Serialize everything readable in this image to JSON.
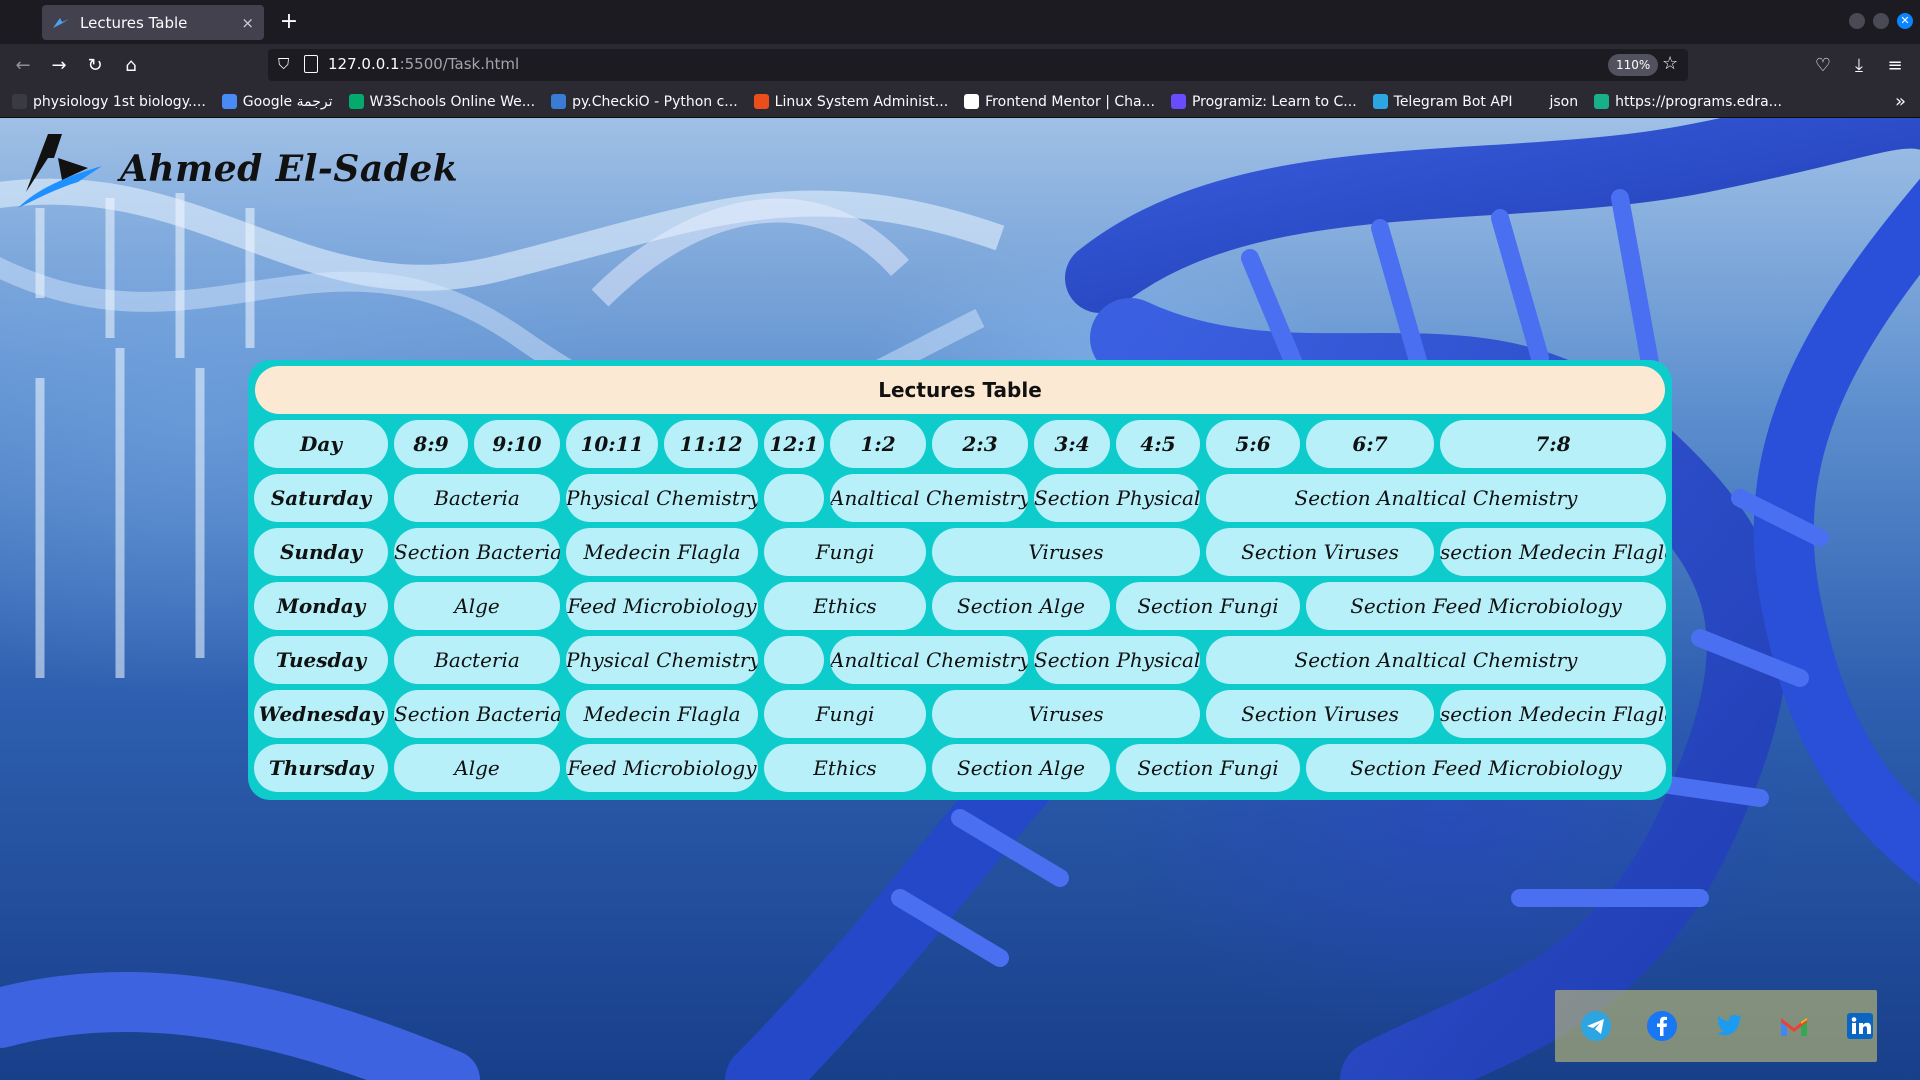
{
  "browser": {
    "tab_title": "Lectures Table",
    "tab_close": "×",
    "new_tab": "+",
    "url_host": "127.0.0.1",
    "url_path": ":5500/Task.html",
    "zoom": "110%",
    "bookmarks": [
      {
        "label": "physiology 1st biology....",
        "color": "#3a3a44"
      },
      {
        "label": "Google ترجمة",
        "color": "#4a8af4"
      },
      {
        "label": "W3Schools Online We...",
        "color": "#04aa6d"
      },
      {
        "label": "py.CheckiO - Python c...",
        "color": "#3a7bd5"
      },
      {
        "label": "Linux System Administ...",
        "color": "#e94e1b"
      },
      {
        "label": "Frontend Mentor | Cha...",
        "color": "#ffffff"
      },
      {
        "label": "Programiz: Learn to C...",
        "color": "#6a4cff"
      },
      {
        "label": "Telegram Bot API",
        "color": "#2ca5e0"
      },
      {
        "label": "json",
        "color": "#2b2a33"
      },
      {
        "label": "https://programs.edra...",
        "color": "#18b08a"
      }
    ]
  },
  "page": {
    "brand": "Ahmed El-Sadek"
  },
  "table": {
    "caption": "Lectures Table",
    "header": [
      "Day",
      "8:9",
      "9:10",
      "10:11",
      "11:12",
      "12:1",
      "1:2",
      "2:3",
      "3:4",
      "4:5",
      "5:6",
      "6:7",
      "7:8"
    ],
    "rows": [
      {
        "day": "Saturday",
        "cells": [
          "Bacteria",
          "Physical Chemistry",
          "",
          "Analtical Chemistry",
          "Section Physical Chemistry",
          "Section Analtical Chemistry"
        ]
      },
      {
        "day": "Sunday",
        "cells": [
          "Section Bacteria",
          "Medecin Flagla",
          "Fungi",
          "Viruses",
          "Section Viruses",
          "section Medecin Flagla"
        ]
      },
      {
        "day": "Monday",
        "cells": [
          "Alge",
          "Feed Microbiology",
          "Ethics",
          "Section Alge",
          "Section Fungi",
          "Section Feed Microbiology"
        ]
      },
      {
        "day": "Tuesday",
        "cells": [
          "Bacteria",
          "Physical Chemistry",
          "",
          "Analtical Chemistry",
          "Section Physical Chemistry",
          "Section Analtical Chemistry"
        ]
      },
      {
        "day": "Wednesday",
        "cells": [
          "Section Bacteria",
          "Medecin Flagla",
          "Fungi",
          "Viruses",
          "Section Viruses",
          "section Medecin Flagla"
        ]
      },
      {
        "day": "Thursday",
        "cells": [
          "Alge",
          "Feed Microbiology",
          "Ethics",
          "Section Alge",
          "Section Fungi",
          "Section Feed Microbiology"
        ]
      }
    ]
  },
  "social": [
    {
      "name": "telegram-icon",
      "color": "#2ca5e0"
    },
    {
      "name": "facebook-icon",
      "color": "#1877f2"
    },
    {
      "name": "twitter-icon",
      "color": "#1d9bf0"
    },
    {
      "name": "gmail-icon",
      "color": "#ea4335"
    },
    {
      "name": "linkedin-icon",
      "color": "#0a66c2"
    }
  ]
}
